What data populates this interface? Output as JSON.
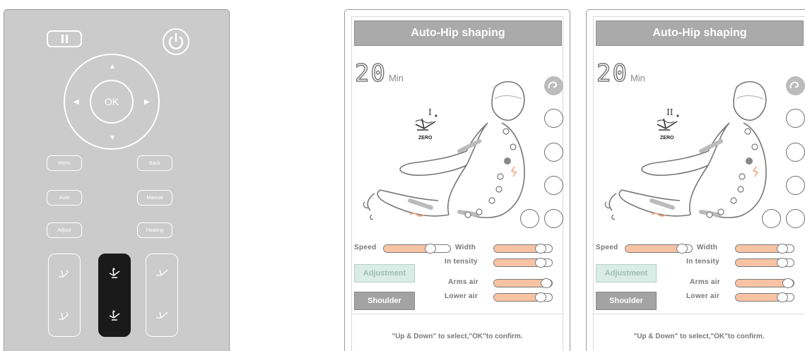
{
  "remote": {
    "ok_label": "OK",
    "buttons": {
      "menu": "Menu",
      "back": "Back",
      "auto": "Auto",
      "manual": "Manual",
      "adjust": "Adjust",
      "heating": "Heating"
    },
    "icons": [
      "pause-icon",
      "power-icon",
      "arrow-up-icon",
      "arrow-down-icon",
      "arrow-left-icon",
      "arrow-right-icon",
      "recline-icon",
      "zero-gravity-icon"
    ]
  },
  "screens": [
    {
      "title": "Auto-Hip shaping",
      "timer_value": "20",
      "timer_unit": "Min",
      "zero_level": "I",
      "zero_label": "ZERO",
      "labels": {
        "speed": "Speed",
        "width": "Width",
        "intensity": "In tensity",
        "arms_air": "Arms air",
        "lower_air": "Lower air"
      },
      "levels": {
        "speed": 0.7,
        "width": 0.8,
        "intensity": 0.8,
        "arms_air": 0.95,
        "lower_air": 0.8
      },
      "adjustment_label": "Adjustment",
      "shoulder_label": "Shoulder",
      "hint": "\"Up & Down\" to select,\"OK\"to confirm."
    },
    {
      "title": "Auto-Hip shaping",
      "timer_value": "20",
      "timer_unit": "Min",
      "zero_level": "II",
      "zero_label": "ZERO",
      "labels": {
        "speed": "Speed",
        "width": "Width",
        "intensity": "In tensity",
        "arms_air": "Arms air",
        "lower_air": "Lower air"
      },
      "levels": {
        "speed": 0.85,
        "width": 0.8,
        "intensity": 0.8,
        "arms_air": 1.0,
        "lower_air": 0.8
      },
      "adjustment_label": "Adjustment",
      "shoulder_label": "Shoulder",
      "hint": "\"Up & Down\" to select,\"OK\"to confirm."
    }
  ],
  "colors": {
    "remote_bg": "#cbcbcb",
    "title_bar": "#aaaaaa",
    "slider_fill": "#f7c3a3",
    "adjust_bg": "#d9ece6",
    "shoulder_bg": "#a3a3a3",
    "massage_marks": "#f0a07a"
  }
}
